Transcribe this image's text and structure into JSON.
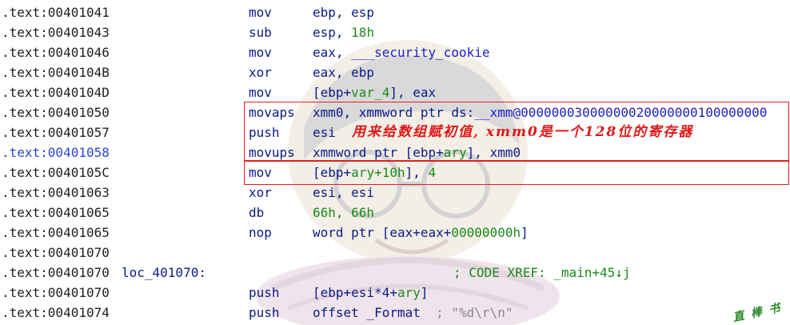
{
  "rows": [
    {
      "addr": ".text:00401041",
      "label": "",
      "mnemonic": "mov",
      "operand": "ebp, esp"
    },
    {
      "addr": ".text:00401043",
      "label": "",
      "mnemonic": "sub",
      "operand_pre": "esp, ",
      "operand_num": "18h"
    },
    {
      "addr": ".text:00401046",
      "label": "",
      "mnemonic": "mov",
      "operand_pre": "eax, ",
      "operand_sym": "___security_cookie"
    },
    {
      "addr": ".text:0040104B",
      "label": "",
      "mnemonic": "xor",
      "operand": "eax, ebp"
    },
    {
      "addr": ".text:0040104D",
      "label": "",
      "mnemonic": "mov",
      "operand_pre": "[ebp+",
      "operand_var": "var_4",
      "operand_post": "], eax"
    },
    {
      "addr": ".text:00401050",
      "label": "",
      "mnemonic": "movaps",
      "operand_pre": "xmm0, xmmword ptr ds:",
      "operand_sym": "__xmm@00000003000000020000000100000000"
    },
    {
      "addr": ".text:00401057",
      "label": "",
      "mnemonic": "push",
      "operand": "esi"
    },
    {
      "addr": ".text:00401058",
      "label": "",
      "mnemonic": "movups",
      "operand_pre": "xmmword ptr [ebp+",
      "operand_var": "ary",
      "operand_post": "], xmm0",
      "highlight": true
    },
    {
      "addr": ".text:0040105C",
      "label": "",
      "mnemonic": "mov",
      "operand_pre": "[ebp+",
      "operand_var": "ary+10h",
      "operand_post": "], ",
      "operand_num": "4"
    },
    {
      "addr": ".text:00401063",
      "label": "",
      "mnemonic": "xor",
      "operand": "esi, esi"
    },
    {
      "addr": ".text:00401065",
      "label": "",
      "mnemonic": "db",
      "operand_num": "66h, 66h"
    },
    {
      "addr": ".text:00401065",
      "label": "",
      "mnemonic": "nop",
      "operand_pre": "word ptr [eax+eax+",
      "operand_num": "00000000h",
      "operand_post": "]"
    },
    {
      "addr": ".text:00401070",
      "label": "",
      "mnemonic": "",
      "operand": ""
    },
    {
      "addr": ".text:00401070",
      "label": "loc_401070:",
      "mnemonic": "",
      "comment": "; CODE XREF: _main+45↓j"
    },
    {
      "addr": ".text:00401070",
      "label": "",
      "mnemonic": "push",
      "operand_pre": "[ebp+esi*4+",
      "operand_var": "ary",
      "operand_post": "]"
    },
    {
      "addr": ".text:00401074",
      "label": "",
      "mnemonic": "push",
      "operand_pre": "offset _Format  ",
      "comment_grey": "; \"%d\\r\\n\""
    }
  ],
  "annotation": {
    "note": "用来给数组赋初值, xmm0是一个128位的寄存器",
    "accent_color": "#e02020"
  },
  "watermark_logo": "直 棒 书"
}
